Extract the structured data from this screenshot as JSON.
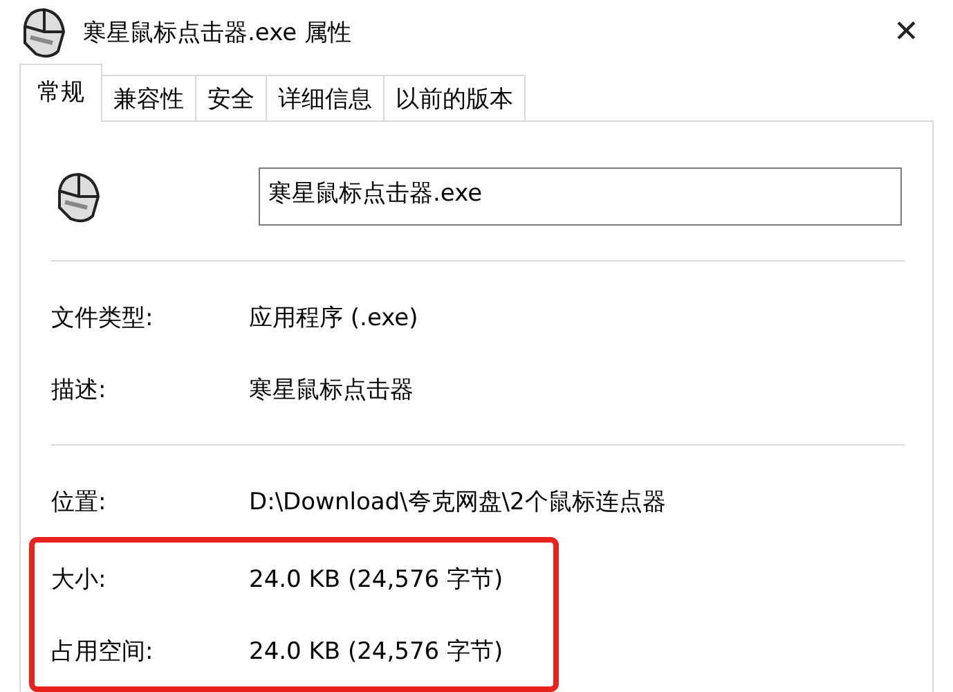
{
  "window": {
    "title": "寒星鼠标点击器.exe 属性",
    "close": "✕"
  },
  "tabs": [
    {
      "label": "常规",
      "selected": true
    },
    {
      "label": "兼容性",
      "selected": false
    },
    {
      "label": "安全",
      "selected": false
    },
    {
      "label": "详细信息",
      "selected": false
    },
    {
      "label": "以前的版本",
      "selected": false
    }
  ],
  "file_name": "寒星鼠标点击器.exe",
  "sections": [
    [
      {
        "label": "文件类型:",
        "value": "应用程序 (.exe)"
      },
      {
        "label": "描述:",
        "value": "寒星鼠标点击器"
      }
    ],
    [
      {
        "label": "位置:",
        "value": "D:\\Download\\夸克网盘\\2个鼠标连点器"
      },
      {
        "label": "大小:",
        "value": "24.0 KB (24,576 字节)",
        "highlighted": true
      },
      {
        "label": "占用空间:",
        "value": "24.0 KB (24,576 字节)",
        "highlighted": true
      }
    ]
  ]
}
